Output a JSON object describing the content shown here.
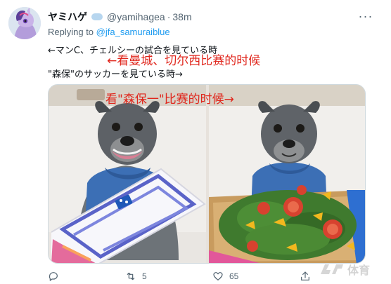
{
  "tweet": {
    "display_name": "ヤミハゲ",
    "handle": "@yamihagea",
    "separator": "·",
    "time": "38m",
    "replying_prefix": "Replying to",
    "replying_to": "@jfa_samuraiblue",
    "line1": "←マンC、チェルシーの試合を見ている時",
    "line2": "\"森保\"のサッカーを見ている時→",
    "overlay_text_1": "←看曼城、切尔西比赛的时候",
    "overlay_text_2": "看\"森保一\"比赛的时候→",
    "more_label": "···"
  },
  "actions": {
    "reply_count": "",
    "retweet_count": "5",
    "like_count": "65",
    "icons": [
      "reply-icon",
      "retweet-icon",
      "like-icon",
      "share-icon"
    ]
  },
  "watermark": {
    "text": "体育"
  },
  "colors": {
    "accent": "#1d9bf0",
    "overlay_red": "#e0261c",
    "muted": "#536471"
  }
}
